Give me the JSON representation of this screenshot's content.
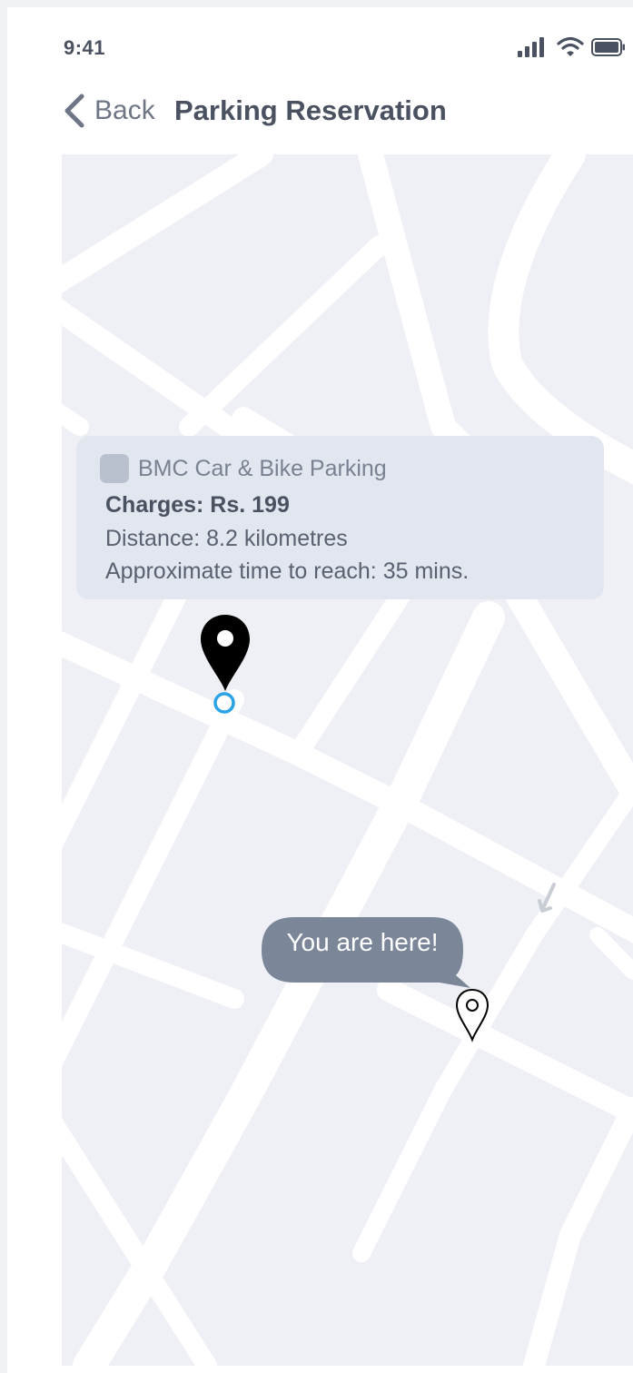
{
  "status_bar": {
    "time": "9:41",
    "icons": [
      "signal-icon",
      "wifi-icon",
      "battery-icon"
    ]
  },
  "nav": {
    "back_label": "Back",
    "title": "Parking Reservation",
    "back_icon": "chevron-left-icon"
  },
  "map": {
    "background_color": "#eef0f6",
    "road_color": "#ffffff",
    "parking_card": {
      "name": "BMC Car & Bike Parking",
      "charges": "Charges: Rs. 199",
      "distance": "Distance: 8.2 kilometres",
      "time": "Approximate time to reach: 35 mins."
    },
    "user_location_label": "You are here!",
    "markers": [
      "parking-pin-icon",
      "location-circle-icon",
      "user-pin-icon",
      "direction-arrow-icon"
    ]
  },
  "colors": {
    "text_primary": "#4a5160",
    "text_secondary": "#7a8292",
    "card_background": "#e1e6ef",
    "bubble_background": "#7b8798",
    "location_ring": "#2aa3e6",
    "pin": "#000000"
  }
}
